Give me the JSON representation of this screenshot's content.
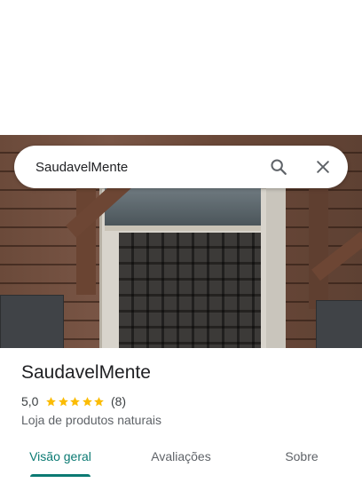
{
  "search": {
    "query": "SaudavelMente"
  },
  "place": {
    "name": "SaudavelMente",
    "rating": "5,0",
    "stars": 5,
    "review_count": "(8)",
    "category": "Loja de produtos naturais"
  },
  "tabs": [
    {
      "label": "Visão geral",
      "active": true
    },
    {
      "label": "Avaliações",
      "active": false
    },
    {
      "label": "Sobre",
      "active": false
    }
  ],
  "colors": {
    "accent": "#0b7a73",
    "star": "#fbbc04"
  },
  "icons": {
    "search": "search-icon",
    "close": "close-icon",
    "star": "star-icon"
  }
}
